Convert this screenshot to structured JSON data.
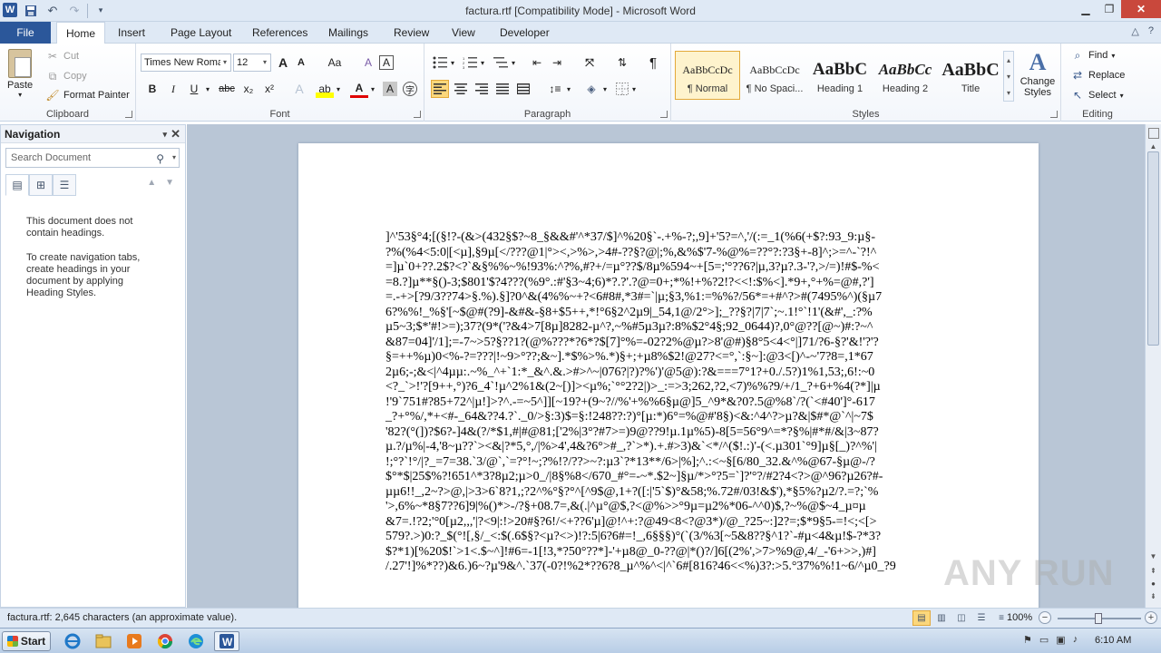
{
  "window": {
    "title": "factura.rtf [Compatibility Mode]  -  Microsoft Word",
    "logo": "W",
    "qat_icons": [
      "save-icon",
      "undo-icon",
      "redo-icon",
      "customize-icon"
    ]
  },
  "ribbon_tabs": {
    "file": "File",
    "tabs": [
      "Home",
      "Insert",
      "Page Layout",
      "References",
      "Mailings",
      "Review",
      "View",
      "Developer"
    ],
    "active": "Home"
  },
  "clipboard": {
    "label": "Clipboard",
    "paste": "Paste",
    "cut": "Cut",
    "copy": "Copy",
    "format_painter": "Format Painter"
  },
  "font": {
    "label": "Font",
    "font_name": "Times New Roman",
    "font_size": "12",
    "bold": "B",
    "italic": "I",
    "underline": "U",
    "strikethrough": "abc",
    "subscript": "x₂",
    "superscript": "x²",
    "grow": "A",
    "shrink": "A",
    "change_case": "Aa",
    "clear": "A",
    "effects": "A",
    "highlight": "ab",
    "font_color": "A",
    "char_shading": "A",
    "enclose": "字"
  },
  "paragraph": {
    "label": "Paragraph"
  },
  "styles": {
    "label": "Styles",
    "items": [
      {
        "sample": "AaBbCcDc",
        "name": "¶ Normal"
      },
      {
        "sample": "AaBbCcDc",
        "name": "¶ No Spaci..."
      },
      {
        "sample": "AaBbC",
        "name": "Heading 1"
      },
      {
        "sample": "AaBbCc",
        "name": "Heading 2"
      },
      {
        "sample": "AaBbC",
        "name": "Title"
      }
    ],
    "change_styles": "Change Styles"
  },
  "editing": {
    "label": "Editing",
    "find": "Find",
    "replace": "Replace",
    "select": "Select"
  },
  "navigation": {
    "title": "Navigation",
    "search_placeholder": "Search Document",
    "message1": "This document does not contain headings.",
    "message2": "To create navigation tabs, create headings in your document by applying Heading Styles."
  },
  "document": {
    "lines": [
      "]^'53§°4;[(§!?-(&>(432§$?~8_§&&#'^*37/$]^%20§`-.+%-?;,9]+'5?=^,'/(:=_1(%6(+$?:93_9:µ§-",
      "?%(%4<5:0|[<µ],§9µ[</???@1|°><,>%>,>4#-??§?@|;%,&%$'7-%@%=??°?:?3§+-8]^;>=^-`?!^",
      "=]µ`0+??.2$?<?`&§%%~%!93%:^?%,#?+/=µ°??$/8µ%594~+[5=;'°??6?|µ,3?µ?.3-'?,>/=)!#$-%<",
      "=8.?]µ**§()-3;$801'$?4???(%9°.:#'§3~4;6)*?.?'.?@=0+;*%!+%?2!?<<!:$%<].*9+,°+%=@#,?']",
      "=.-+>[?9/3??74>§.%).§]?0^&(4%%~+?<6#8#,*3#=`|µ;§3,%1:=%%?/56*=+#^?>#(7495%^)(§µ7",
      "6?%%!_%§'[~$@#(?9]-&#&-§8+$5++,*!°6§2^2µ9|_54,1@/2°>];_??§?|7|7`;~.1!°`!1'(&#',_:?%",
      "µ5~3;$*'#!>=);37?(9*('?&4>7[8µ]8282-µ^?,~%#5µ3µ?:8%$2°4§;92_0644)?,0°@??[@~)#:?~^",
      "&87=04]'/1];=-7~>5?§??1?(@%???*?6*?$[7]°%=-02?2%@µ?>8'@#)§8°5<4<°|]71/?6-§?'&!'?'?",
      "§=++%µ)0<%-?=???|!~9>°??;&~].*$%>%.*)§+;+µ8%$2!@27?<=°,`:§~]:@3<[)^-~'7?8=,1*67",
      "2µ6;-;&<|^4µµ:.~%_^+`1:*_&^.&.>#>^~|076?|?)?%')'@5@):?&===7°1?+0./.5?)1%1,53;,6!:~0",
      "<?_`>!'?[9++,°)?6_4`!µ^2%1&(2~[)]><µ%;`°°2?2|)>_:=>3;262,?2,<7)%%?9/+/1_?+6+%4(?*]|µ",
      "!'9`751#?85+72^|µ!]>?^.-=~5^]][~19?+(9~?//%'+%%6§µ@]5_^9*&?0?.5@%8`/?(`<#40']°-617",
      "_?+°%/,*+<#-_64&??4.?`._0/>§:3)$=§:!248??:?)°[µ:*)6°=%@#'8§)<&:^4^?>µ?&|$#*@`^|~7$",
      "'82?(°(])?$6?-]4&(?/*$1,#|#@81;['2%|3°?#7>=)9@??9!µ.1µ%5)-8[5=56°9^=*?§%|#*#/&|3~87?",
      "µ.?/µ%|-4,'8~µ??`><&|?*5,°,/|%>4',4&?6°>#_,?`>*).+.#>3)&`<*/^($!.:)'-(<.µ301`°9]µ§[_)?^%'|",
      "!;°?`!°/|?_=7=38.`3/@`,`=?°!~;?%!?/??>~?:µ3`?*13**/6>|%];^.:<~§[6/80_32.&^%@67-§µ@-/?",
      "$°*$|25$%?!651^*3?8µ2;µ>0_/|8§%8</670_#°=-~*.$2~]§µ/*>°?5=`]?'°?/#2?4<?>@^96?µ26?#-",
      "µµ6!!_,2~?>@,|>3>6`8?1,;?2^%°§?°^[^9$@,1+?([:|'5`$)°&58;%.72#/03!&$'),*§5%?µ2/?.=?;`%",
      "'>,6%~*8§7??6]9|%()*>-/?§+08.7=,&(.|^µ°@$,?<@%>>°9µ=µ2%*06-^^0)$,?~%@$~4_µ¤µ",
      "&7=.!?2;'°0[µ2,,,'|?<9|:!>20#§?6!/<+??6'µ]@!^+:?@49<8<?@3*)/@_?25~:]2?=;$*9§5-=!<;<[>",
      "579?.>)0:?_$(°![,§/_<:$(.6$§?<µ?<>)!?:5|6?6#=!_,6§§§)°(`(3/%3[~5&8??§^1?`-#µ<4&µ!$-?*3?",
      "$?*1)[%20$!`>1<.$~^]!#6=-1[!3,*?50°??*]-'+µ8@_0-??@|*()?/]6[(2%',>7>%9@,4/_-'6+>>,)#]",
      "/.27'!]%*??)&6.)6~?µ'9&^.`37(-0?!%2*??6?8_µ^%^<|^`6#[816?46<<%)3?:>5.°37%%!1~6/^µ0_?9"
    ]
  },
  "status": {
    "text": "factura.rtf: 2,645 characters (an approximate value).",
    "zoom": "100%",
    "zoom_level": 0.5
  },
  "taskbar": {
    "start": "Start",
    "clock": "6:10 AM",
    "pinned": [
      "ie-icon",
      "explorer-icon",
      "media-player-icon",
      "chrome-icon",
      "edge-icon",
      "word-icon"
    ]
  },
  "watermark": "ANY RUN"
}
